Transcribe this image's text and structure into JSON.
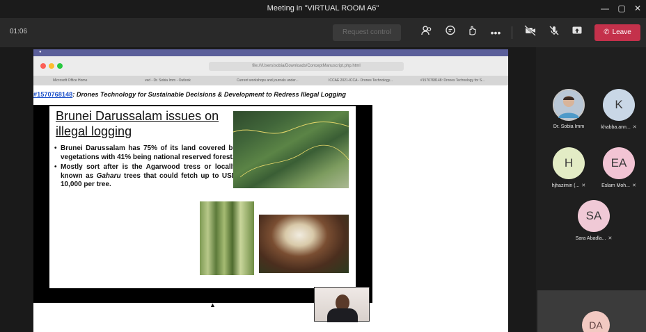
{
  "window": {
    "title": "Meeting in \"VIRTUAL ROOM A6\""
  },
  "toolbar": {
    "timer": "01:06",
    "request_control_label": "Request control",
    "leave_label": "Leave"
  },
  "browser": {
    "address": "file:///Users/sobia/Downloads/ConceptManuscript.php.html",
    "tabs": [
      "Microsoft Office Home",
      "ved - Dr. Sobia Imm - Outlook",
      "Current workshops and journals under...",
      "ICCAE 2021-ICCA - Drones Technology...",
      "#1570768148: Drones Technology for S..."
    ]
  },
  "paper": {
    "id": "#1570768148",
    "title": ": Drones Technology for Sustainable Decisions & Development to Redress Illegal Logging"
  },
  "slide": {
    "title": "Brunei Darussalam issues on illegal logging",
    "bullet1": "Brunei Darussalam has 75% of its land covered by vegetations with 41% being national reserved forest.",
    "bullet2_pre": "Mostly sort after is the Agarwood tress or locally known as ",
    "bullet2_em": "Gaharu",
    "bullet2_post": " trees that could fetch up to USD 10,000 per tree."
  },
  "participants": [
    {
      "name": "Dr. Sobia Imm",
      "initials": "",
      "color": "#8aa9c9"
    },
    {
      "name": "khabba.ann...",
      "initials": "K",
      "color": "#c9d7e6"
    },
    {
      "name": "hjhazimin (...",
      "initials": "H",
      "color": "#e3ecc5"
    },
    {
      "name": "Eslam Moh...",
      "initials": "EA",
      "color": "#f2c4d4"
    },
    {
      "name": "Sara Abadla...",
      "initials": "SA",
      "color": "#f0c9d6"
    },
    {
      "name": "",
      "initials": "DA",
      "color": "#f2c9c2"
    }
  ]
}
